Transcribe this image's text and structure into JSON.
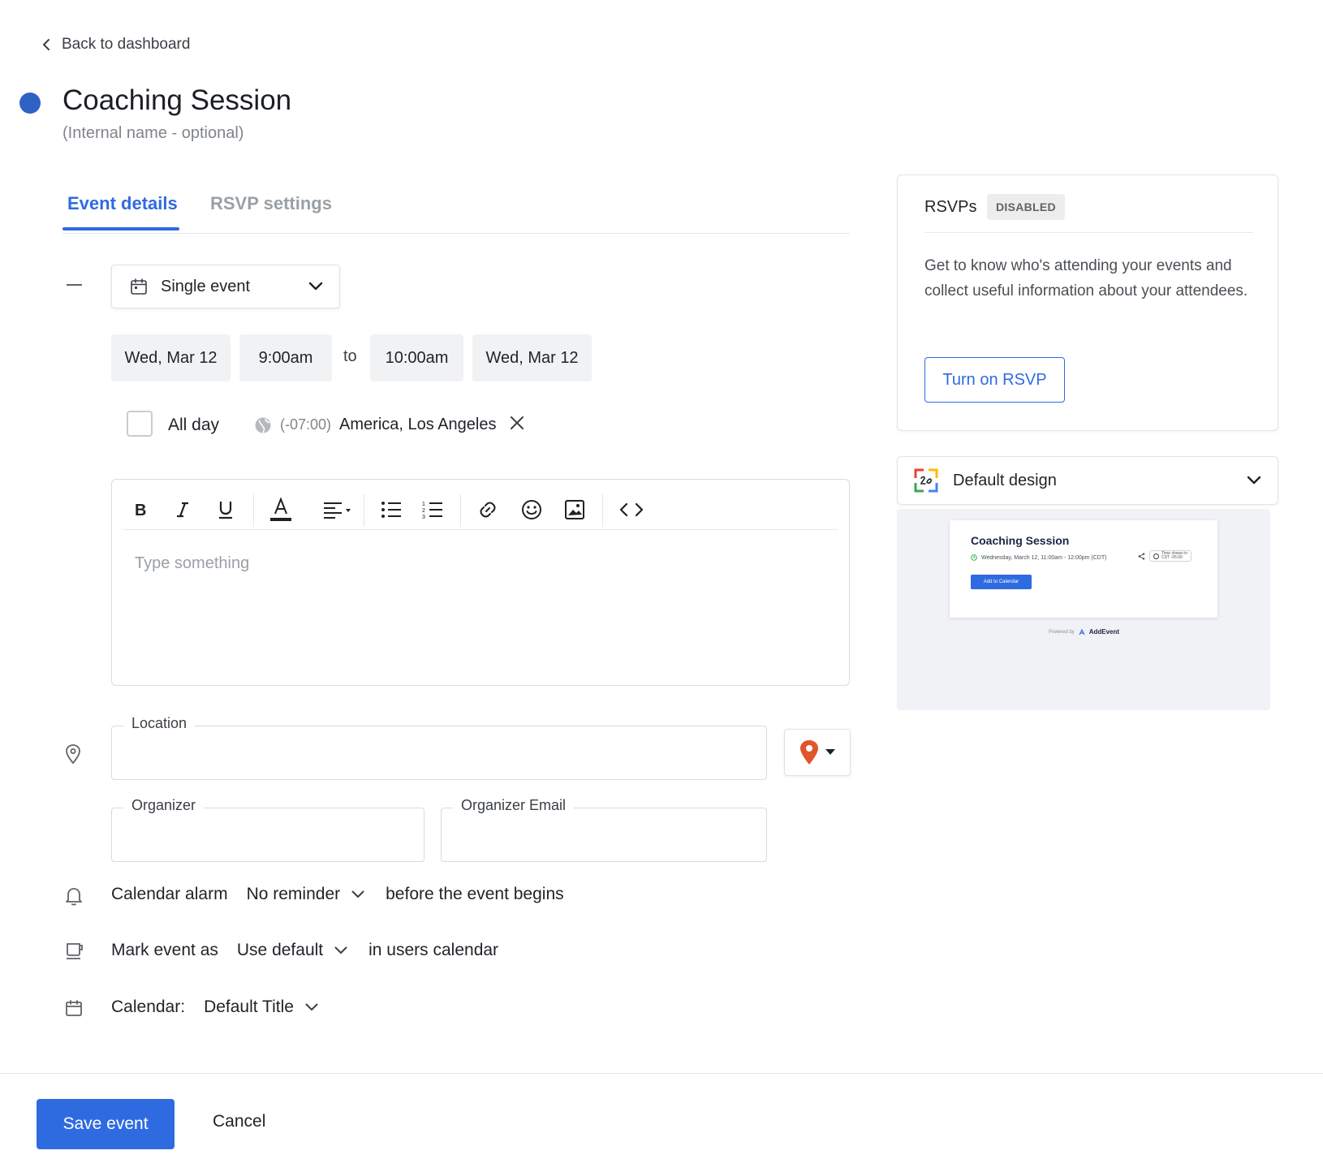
{
  "header": {
    "back_label": "Back to dashboard",
    "title": "Coaching Session",
    "subtitle": "(Internal name - optional)",
    "color_dot": "#2f62c4"
  },
  "tabs": [
    {
      "label": "Event details",
      "active": true
    },
    {
      "label": "RSVP settings",
      "active": false
    }
  ],
  "schedule": {
    "event_type": "Single event",
    "start_date": "Wed, Mar 12",
    "start_time": "9:00am",
    "to_label": "to",
    "end_time": "10:00am",
    "end_date": "Wed, Mar 12",
    "all_day_label": "All day",
    "all_day_checked": false,
    "timezone_offset": "(-07:00)",
    "timezone_name": "America, Los Angeles"
  },
  "editor": {
    "placeholder": "Type something",
    "toolbar": [
      "bold-icon",
      "italic-icon",
      "underline-icon",
      "text-color-icon",
      "align-icon",
      "bullet-list-icon",
      "numbered-list-icon",
      "link-icon",
      "emoji-icon",
      "image-icon",
      "code-icon"
    ]
  },
  "fields": {
    "location_label": "Location",
    "location_value": "",
    "organizer_label": "Organizer",
    "organizer_value": "",
    "organizer_email_label": "Organizer Email",
    "organizer_email_value": ""
  },
  "alarm": {
    "label": "Calendar alarm",
    "value": "No reminder",
    "suffix": "before the event begins"
  },
  "mark": {
    "label": "Mark event as",
    "value": "Use default",
    "suffix": "in users calendar"
  },
  "calendar": {
    "label": "Calendar:",
    "value": "Default Title"
  },
  "rsvp_card": {
    "title": "RSVPs",
    "badge": "DISABLED",
    "description": "Get to know who's attending your events and collect useful information about your attendees.",
    "button": "Turn on RSVP"
  },
  "design": {
    "label": "Default design",
    "preview": {
      "title": "Coaching Session",
      "date": "Wednesday, March 12, 11:00am - 12:00pm (CDT)",
      "tz_line1": "Time shown in",
      "tz_line2": "CDT -05:00",
      "button": "Add to Calendar",
      "powered_by": "Powered by",
      "brand": "AddEvent"
    }
  },
  "footer": {
    "save": "Save event",
    "cancel": "Cancel"
  },
  "colors": {
    "accent": "#2f6be0",
    "pin": "#e0562b"
  }
}
